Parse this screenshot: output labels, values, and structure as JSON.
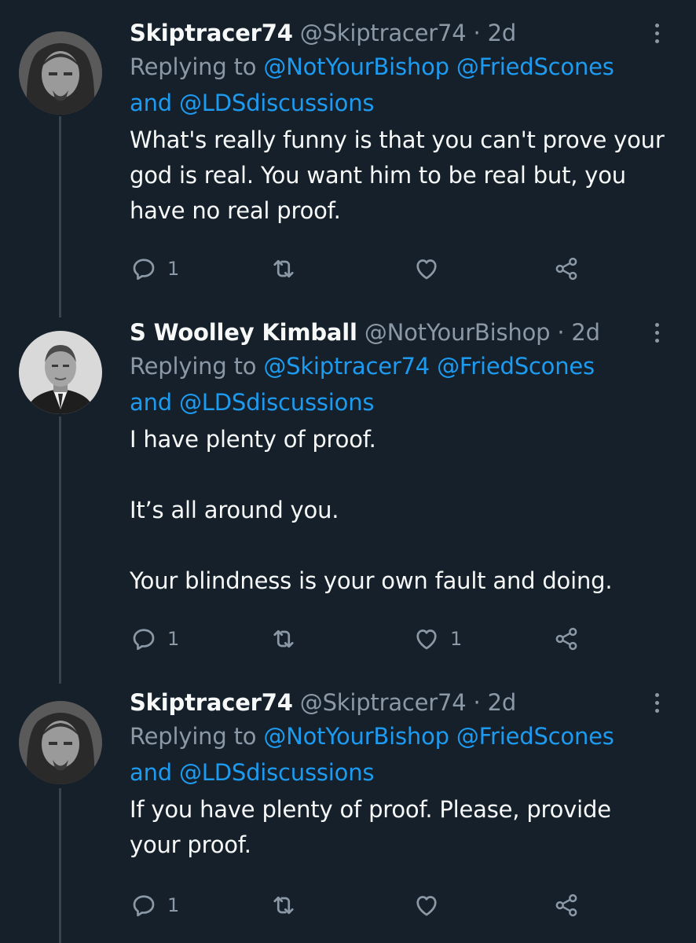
{
  "tweets": [
    {
      "name": "Skiptracer74",
      "handle": "@Skiptracer74",
      "time": "2d",
      "replying_prefix": "Replying to ",
      "mention1": "@NotYourBishop",
      "mention2": "@FriedScones",
      "and": "and ",
      "mention3": "@LDSdiscussions",
      "text": "What's really funny is that you can't prove your god is real. You want him to be real but, you have no real proof.",
      "replies": "1",
      "retweets": "",
      "likes": ""
    },
    {
      "name": "S Woolley Kimball",
      "handle": "@NotYourBishop",
      "time": "2d",
      "replying_prefix": "Replying to ",
      "mention1": "@Skiptracer74",
      "mention2": "@FriedScones",
      "and": "and ",
      "mention3": "@LDSdiscussions",
      "text": "I have plenty of proof.\n\nIt’s all around you.\n\nYour blindness is your own fault and doing.",
      "replies": "1",
      "retweets": "",
      "likes": "1"
    },
    {
      "name": "Skiptracer74",
      "handle": "@Skiptracer74",
      "time": "2d",
      "replying_prefix": "Replying to ",
      "mention1": "@NotYourBishop",
      "mention2": "@FriedScones",
      "and": "and ",
      "mention3": "@LDSdiscussions",
      "text": "If you have plenty of proof. Please, provide your proof.",
      "replies": "1",
      "retweets": "",
      "likes": ""
    }
  ],
  "separator": " · ",
  "icons": {
    "reply": "reply-icon",
    "retweet": "retweet-icon",
    "like": "heart-icon",
    "share": "share-icon",
    "more": "more-options-icon"
  },
  "colors": {
    "background": "#15202b",
    "text": "#f7f9f9",
    "secondary": "#8b98a5",
    "link": "#1d9bf0",
    "thread_line": "#38444d"
  }
}
